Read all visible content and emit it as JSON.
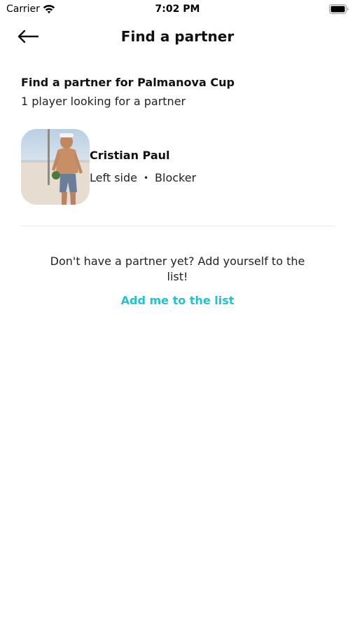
{
  "status_bar": {
    "carrier": "Carrier",
    "time": "7:02 PM"
  },
  "nav": {
    "title": "Find a partner",
    "back_icon": "arrow-left-icon"
  },
  "section": {
    "title": "Find a partner for Palmanova Cup",
    "subtitle": "1 player looking for a partner"
  },
  "players": [
    {
      "name": "Cristian Paul",
      "side": "Left side",
      "separator": "•",
      "role": "Blocker"
    }
  ],
  "empty_state": {
    "message": "Don't have a partner yet? Add yourself to the list!",
    "action_label": "Add me to the list"
  },
  "colors": {
    "accent": "#22c3cf",
    "divider": "#e8e8e8",
    "text": "#111111"
  }
}
